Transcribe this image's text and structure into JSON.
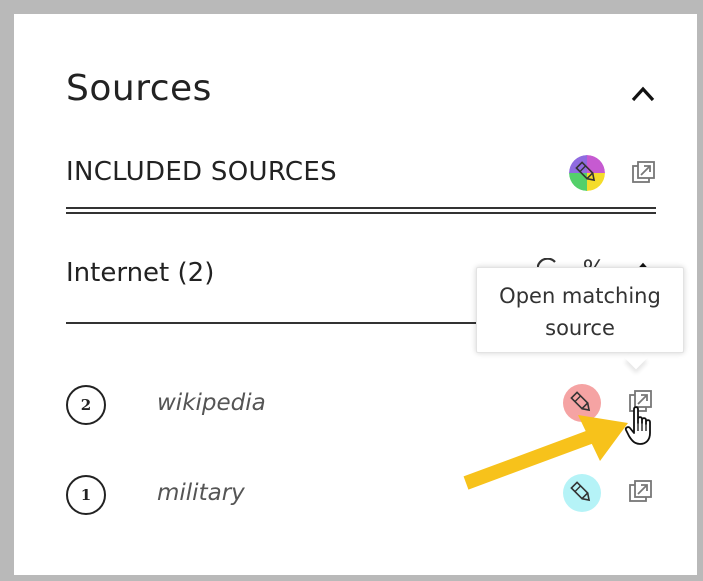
{
  "panel": {
    "title": "Sources"
  },
  "included": {
    "label": "INCLUDED SOURCES"
  },
  "internet": {
    "label": "Internet (2)",
    "percent_symbol": "%"
  },
  "tooltip": {
    "line1": "Open matching",
    "line2": "source"
  },
  "sources": [
    {
      "rank": "2",
      "name": "wikipedia",
      "highlight_color": "#f5a3a3"
    },
    {
      "rank": "1",
      "name": "military",
      "highlight_color": "#b5f3f7"
    }
  ],
  "colors": {
    "frame": "#b9b9b9",
    "arrow": "#f7c21b"
  }
}
